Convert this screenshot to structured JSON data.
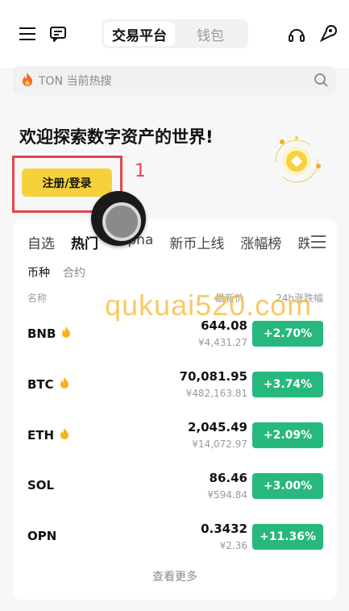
{
  "header": {
    "segments": [
      "交易平台",
      "钱包"
    ],
    "active_segment": 0
  },
  "search": {
    "placeholder": "TON 当前热搜"
  },
  "hero": {
    "title": "欢迎探索数字资产的世界!",
    "register_label": "注册/登录",
    "annotation_number": "1"
  },
  "market": {
    "tabs": [
      "自选",
      "热门",
      "Alpha",
      "新币上线",
      "涨幅榜",
      "跌"
    ],
    "active_tab": 1,
    "subtabs": [
      "币种",
      "合约"
    ],
    "active_subtab": 0,
    "columns": {
      "name": "名称",
      "price": "最新价",
      "change": "24h涨跌幅"
    },
    "rows": [
      {
        "symbol": "BNB",
        "hot": true,
        "price": "644.08",
        "cny": "¥4,431.27",
        "change": "+2.70%"
      },
      {
        "symbol": "BTC",
        "hot": true,
        "price": "70,081.95",
        "cny": "¥482,163.81",
        "change": "+3.74%"
      },
      {
        "symbol": "ETH",
        "hot": true,
        "price": "2,045.49",
        "cny": "¥14,072.97",
        "change": "+2.09%"
      },
      {
        "symbol": "SOL",
        "hot": false,
        "price": "86.46",
        "cny": "¥594.84",
        "change": "+3.00%"
      },
      {
        "symbol": "OPN",
        "hot": false,
        "price": "0.3432",
        "cny": "¥2.36",
        "change": "+11.36%"
      }
    ],
    "more_label": "查看更多"
  },
  "watermark": "qukuai520.com",
  "colors": {
    "accent_yellow": "#f7d13c",
    "up_green": "#27b87e",
    "annotation_red": "#e8434b"
  }
}
